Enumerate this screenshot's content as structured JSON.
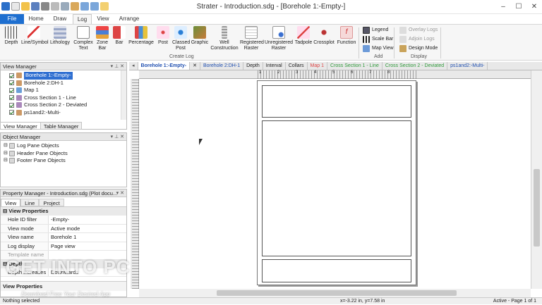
{
  "window": {
    "title": "Strater - Introduction.sdg - [Borehole 1:-Empty-]"
  },
  "ribbon_tabs": [
    "File",
    "Home",
    "Draw",
    "Log",
    "View",
    "Arrange"
  ],
  "ribbon": {
    "create_log": {
      "label": "Create Log",
      "buttons": [
        "Depth",
        "Line/Symbol",
        "Lithology",
        "Complex Text",
        "Zone Bar",
        "Bar",
        "Percentage",
        "Post",
        "Classed Post",
        "Graphic",
        "Well Construction",
        "Registered Raster",
        "Unregistered Raster",
        "Tadpole",
        "Crossplot",
        "Function"
      ]
    },
    "add": {
      "label": "Add",
      "buttons": [
        "Legend",
        "Scale Bar",
        "Map View"
      ]
    },
    "display": {
      "label": "Display",
      "buttons": [
        "Overlay Logs",
        "Adjoin Logs",
        "Design Mode"
      ]
    }
  },
  "view_manager": {
    "title": "View Manager",
    "items": [
      "Borehole 1:-Empty-",
      "Borehole 2:DH-1",
      "Map 1",
      "Cross Section 1 - Line",
      "Cross Section 2 - Deviated",
      "ps1and2:-Multi-"
    ],
    "tabs": [
      "View Manager",
      "Table Manager"
    ]
  },
  "object_manager": {
    "title": "Object Manager",
    "items": [
      "Log Pane Objects",
      "Header Pane Objects",
      "Footer Pane Objects"
    ]
  },
  "property_manager": {
    "title": "Property Manager - Introduction.sdg (Plot docu...",
    "tabs": [
      "View",
      "Line",
      "Project"
    ],
    "category": "View Properties",
    "rows": [
      {
        "k": "Hole ID filter",
        "v": "-Empty-"
      },
      {
        "k": "View mode",
        "v": "Active mode"
      },
      {
        "k": "View name",
        "v": "Borehole 1"
      },
      {
        "k": "Log display mode",
        "v": "Page view"
      },
      {
        "k": "Template name",
        "v": ""
      }
    ],
    "category2": "Depth",
    "rows2": [
      {
        "k": "Depth increases",
        "v": "Downwards"
      }
    ],
    "footer": "View Properties"
  },
  "doc_tabs": [
    "Borehole 1:-Empty-",
    "Borehole 2:DH-1",
    "Depth",
    "Interval",
    "Collars",
    "Map 1",
    "Cross Section 1 - Line",
    "Cross Section 2 - Deviated",
    "ps1and2:-Multi-"
  ],
  "ruler_labels": [
    "1",
    "2",
    "3",
    "4",
    "5",
    "6",
    "7",
    "8"
  ],
  "status": {
    "left": "Nothing selected",
    "coords": "x=-3.22 in, y=7.58 in",
    "page": "Active - Page 1 of 1"
  },
  "watermark": {
    "line1": "GET INTO PC",
    "line2": "Download Free Your Desired App"
  }
}
